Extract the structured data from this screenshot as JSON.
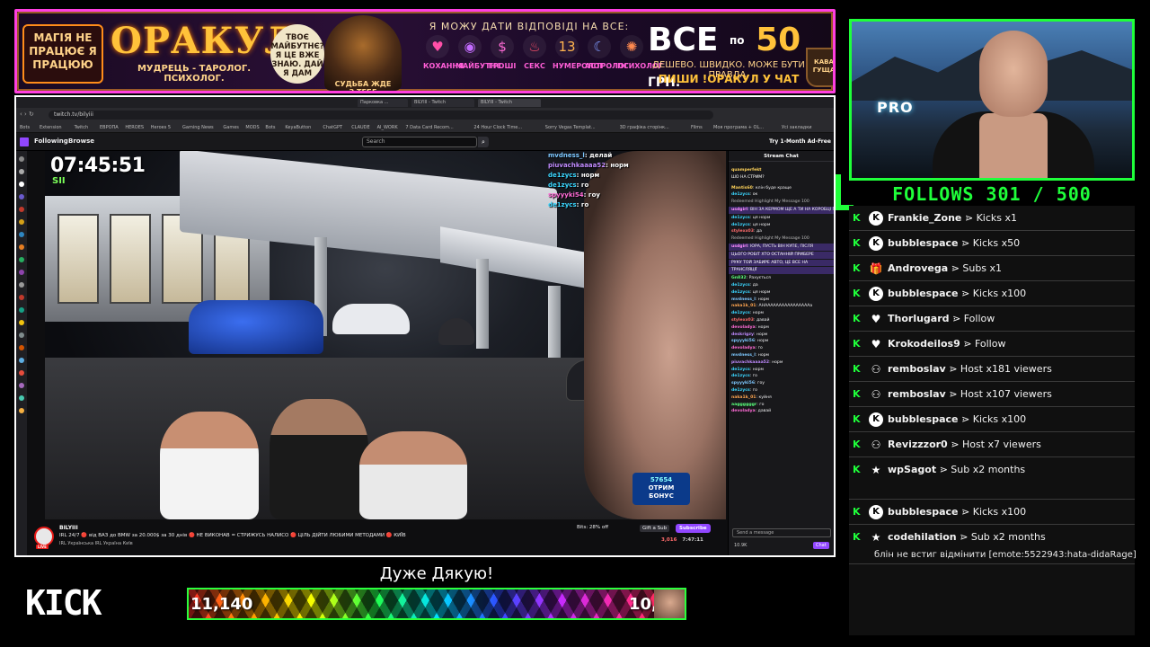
{
  "banner": {
    "left_text": "МАГІЯ НЕ ПРАЦЮЄ Я ПРАЦЮЮ",
    "title": "ОРАКУЛ",
    "subtitle": "МУДРЕЦЬ - ТАРОЛОГ. ПСИХОЛОГ.",
    "bubble": "ТВОЄ МАЙБУТНЄ? Я ЦЕ ВЖЕ ЗНАЮ. ДАЙ Я ДАМ",
    "wizard_caption": "СУДЬБА ЖДЕ З ТЕБЕ",
    "headline": "Я МОЖУ ДАТИ ВІДПОВІДІ НА ВСЕ:",
    "topics": [
      {
        "label": "КОХАННЯ",
        "icon": "heart-icon",
        "glyph": "♥",
        "color": "#ff4fa8"
      },
      {
        "label": "МАЙБУТНЄ",
        "icon": "crystal-ball-icon",
        "glyph": "◉",
        "color": "#c36bff"
      },
      {
        "label": "ГРОШІ",
        "icon": "money-icon",
        "glyph": "$",
        "color": "#ff6bd6"
      },
      {
        "label": "СЕКС",
        "icon": "apple-icon",
        "glyph": "♨",
        "color": "#ff4f6b"
      },
      {
        "label": "НУМЕРОЛОГ",
        "icon": "numbers-icon",
        "glyph": "13",
        "color": "#ffb34f"
      },
      {
        "label": "АСТРОЛОГ",
        "icon": "moon-icon",
        "glyph": "☾",
        "color": "#7f9bff"
      },
      {
        "label": "ПСИХОЛОГ",
        "icon": "brain-icon",
        "glyph": "✺",
        "color": "#ff8a4f"
      }
    ],
    "price_prefix": "ВСЕ",
    "price_mid": "по",
    "price_num": "50",
    "price_cur": "ГРН.",
    "tagline": "ДЕШЕВО. ШВИДКО. МОЖЕ БУТИ ПРАВДА.",
    "cta": "ПИШИ !ОРАКУЛ У ЧАТ",
    "cup": "КАВА ГУЩА"
  },
  "browser": {
    "tabs": [
      "BILYIII - Twitch",
      "Парковка ...",
      "BILYIII - Twitch"
    ],
    "url": "twitch.tv/bilyiii",
    "bookmarks": [
      "Bots",
      "Extension",
      "Twitch",
      "ЕВРОПА",
      "HEROES",
      "Heroes 5",
      "Gaming News",
      "Games",
      "MODS",
      "Bots",
      "KeyaButton",
      "ChatGPT",
      "CLAUDE",
      "AI_WORK",
      "7 Data Card Recom...",
      "24 Hour Clock Time...",
      "Sorry Vegas Templat...",
      "3D графіка сторінк...",
      "Films",
      "Моя програма + OL...",
      "Усі закладки"
    ],
    "nav_following": "Following",
    "nav_browse": "Browse",
    "search_placeholder": "Search",
    "ad_free": "Try 1-Month Ad-Free"
  },
  "video": {
    "clock": "07:45:51",
    "clock_sub": "SII",
    "overlay_chat": [
      {
        "user": "mvdness_l",
        "msg": "делай",
        "color": "#7ec8ff"
      },
      {
        "user": "piuvachkaaaa52",
        "msg": "норм",
        "color": "#c08bff"
      },
      {
        "user": "de1zycs",
        "msg": "норм",
        "color": "#3bd6ff"
      },
      {
        "user": "de1zycs",
        "msg": "го",
        "color": "#3bd6ff"
      },
      {
        "user": "spyyyki54",
        "msg": "гоу",
        "color": "#ff6bd6"
      },
      {
        "user": "de1zycs",
        "msg": "го",
        "color": "#3bd6ff"
      }
    ],
    "promo_num": "57654",
    "promo_line1": "ОТРИМ",
    "promo_line2": "БОНУС"
  },
  "stream_info": {
    "channel": "BILYIII",
    "live": "LIVE",
    "title": "IRL 24/7 🔴 від ВАЗ до BMW за 20.000$ за 30 днів 🔴 НЕ ВИКОНАВ = СТРИЖУСЬ НАЛИСО 🔴 ЦІЛЬ ДІЙТИ ЛЮБИМИ МЕТОДАМИ 🔴 КИЇВ",
    "tags": "IRL  Українська  IRL  Україна  Київ",
    "bits": "Bits: 28% off",
    "gift": "Gift a Sub",
    "subscribe": "Subscribe",
    "viewers": "3,016",
    "uptime": "7:47:11"
  },
  "twitch_chat": {
    "header": "Stream Chat",
    "pinned_user": "quamperfekt",
    "pinned_msg": "ШО НА СТРИМ?",
    "lines": [
      {
        "user": "Mantis60",
        "msg": "клін буде краще",
        "color": "#ffd35a"
      },
      {
        "user": "de1zycs",
        "msg": "ок",
        "color": "#3bd6ff"
      },
      {
        "user": "",
        "msg": "Redeemed Highlight My Message 100",
        "color": "#bbb"
      },
      {
        "user": "usdgirl",
        "msg": "ВІН ЗА КЕРМОМ ЩЕ А ТИ НА КОРОБЦІ ПЕРЕДАЧІ",
        "color": "#ff8cff",
        "hl": true
      },
      {
        "user": "de1zycs",
        "msg": "ця норм",
        "color": "#3bd6ff"
      },
      {
        "user": "de1zycs",
        "msg": "ця норм",
        "color": "#3bd6ff"
      },
      {
        "user": "stylexx03",
        "msg": "да",
        "color": "#ff6b6b"
      },
      {
        "user": "",
        "msg": "Redeemed Highlight My Message 100",
        "color": "#bbb"
      },
      {
        "user": "usdgirl",
        "msg": "ЮРА, ПУСТЬ ВІН КУПЕ, ПІСЛЯ",
        "color": "#ff8cff",
        "hl": true
      },
      {
        "user": "",
        "msg": "ЦЬОГО РОБІТ ХТО ОСТАННІЙ ПРИБЕРЕ",
        "color": "#fff",
        "hl": true
      },
      {
        "user": "",
        "msg": "РУКУ ТОЙ ЗАБИРЕ АВТО, ЦЕ ВСЕ НА",
        "color": "#fff",
        "hl": true
      },
      {
        "user": "",
        "msg": "ТРАНСЛЯЦІЇ",
        "color": "#fff",
        "hl": true
      },
      {
        "user": "Gn832",
        "msg": "Рахується",
        "color": "#5aff7c"
      },
      {
        "user": "de1zycs",
        "msg": "да",
        "color": "#3bd6ff"
      },
      {
        "user": "de1zycs",
        "msg": "ця норм",
        "color": "#3bd6ff"
      },
      {
        "user": "mvdness_l",
        "msg": "норм",
        "color": "#7ec8ff"
      },
      {
        "user": "naka1k_01",
        "msg": "АНААААААААААААААААа",
        "color": "#ffa54f"
      },
      {
        "user": "de1zycs",
        "msg": "норм",
        "color": "#3bd6ff"
      },
      {
        "user": "stylexx03",
        "msg": "давай",
        "color": "#ff6b6b"
      },
      {
        "user": "devoladya",
        "msg": "норм",
        "color": "#ff6bd6"
      },
      {
        "user": "deskrigzy",
        "msg": "норм",
        "color": "#c08bff"
      },
      {
        "user": "spyyyki56",
        "msg": "норм",
        "color": "#7ec8ff"
      },
      {
        "user": "devoladya",
        "msg": "го",
        "color": "#ff6bd6"
      },
      {
        "user": "mvdness_l",
        "msg": "норм",
        "color": "#7ec8ff"
      },
      {
        "user": "piuvachkaaaa52",
        "msg": "норм",
        "color": "#c08bff"
      },
      {
        "user": "de1zycs",
        "msg": "норм",
        "color": "#3bd6ff"
      },
      {
        "user": "de1zycs",
        "msg": "го",
        "color": "#3bd6ff"
      },
      {
        "user": "spyyyki56",
        "msg": "гоу",
        "color": "#7ec8ff"
      },
      {
        "user": "de1zycs",
        "msg": "го",
        "color": "#3bd6ff"
      },
      {
        "user": "naka1k_01",
        "msg": "куйня",
        "color": "#ffa54f"
      },
      {
        "user": "aaggggggr",
        "msg": "го",
        "color": "#5aff7c"
      },
      {
        "user": "devoladya",
        "msg": "давай",
        "color": "#ff6bd6"
      }
    ],
    "send_placeholder": "Send a message",
    "points": "10.9K",
    "chat_button": "Chat"
  },
  "follows": {
    "label": "FOLLOWS 301 / 500"
  },
  "events": [
    {
      "user": "Frankie_Zone",
      "action": "Kicks x1",
      "icon": "kick-coin-icon",
      "glyph": "K"
    },
    {
      "user": "bubblespace",
      "action": "Kicks x50",
      "icon": "kick-coin-icon",
      "glyph": "K"
    },
    {
      "user": "Androvega",
      "action": "Subs x1",
      "icon": "gift-icon",
      "glyph": "🎁"
    },
    {
      "user": "bubblespace",
      "action": "Kicks x100",
      "icon": "kick-coin-icon",
      "glyph": "K"
    },
    {
      "user": "Thorlugard",
      "action": "Follow",
      "icon": "heart-icon",
      "glyph": "♥"
    },
    {
      "user": "Krokodeilos9",
      "action": "Follow",
      "icon": "heart-icon",
      "glyph": "♥"
    },
    {
      "user": "remboslav",
      "action": "Host x181 viewers",
      "icon": "host-icon",
      "glyph": "⚇"
    },
    {
      "user": "remboslav",
      "action": "Host x107 viewers",
      "icon": "host-icon",
      "glyph": "⚇"
    },
    {
      "user": "bubblespace",
      "action": "Kicks x100",
      "icon": "kick-coin-icon",
      "glyph": "K"
    },
    {
      "user": "Revizzzor0",
      "action": "Host x7 viewers",
      "icon": "host-icon",
      "glyph": "⚇"
    },
    {
      "user": "wpSagot",
      "action": "Sub x2 months",
      "icon": "star-icon",
      "glyph": "★"
    },
    {
      "user": "bubblespace",
      "action": "Kicks x100",
      "icon": "kick-coin-icon",
      "glyph": "K"
    },
    {
      "user": "codehilation",
      "action": "Sub x2 months",
      "icon": "star-icon",
      "glyph": "★",
      "note": "блін не встиг відмінити [emote:5522943:hata-didaRage]"
    }
  ],
  "bottom": {
    "kick_logo": "KICK",
    "thanks": "Дуже Дякую!",
    "goal_current": "11,140",
    "goal_target": "10,"
  }
}
